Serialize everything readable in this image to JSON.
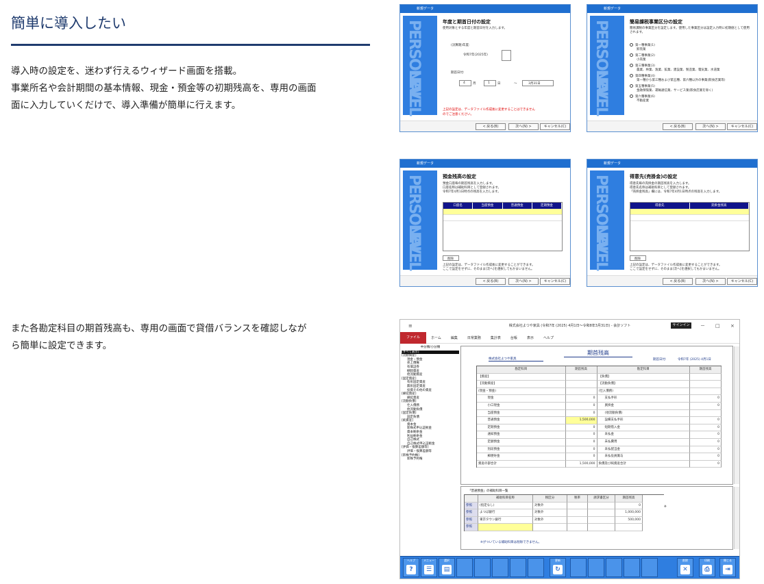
{
  "section1": {
    "heading": "簡単に導入したい",
    "line1": "導入時の設定を、迷わず行えるウィザード画面を搭載。",
    "line2": "事業所名や会計期間の基本情報、現金・預金等の初期残高を、専用の画面",
    "line3": "面に入力していくだけで、導入準備が簡単に行えます。"
  },
  "section2": {
    "line1": "また各勘定科目の期首残高も、専用の画面で貸借バランスを確認しなが",
    "line2": "ら簡単に設定できます。"
  },
  "wizard_common": {
    "titlebar": "新規データ",
    "side_text_a": "PERSONAL",
    "side_text_b": "LEVEL",
    "back": "< 戻る(B)",
    "next": "次へ(N) >",
    "cancel": "キャンセル(C)"
  },
  "wizard1": {
    "title": "年度と期首日付の設定",
    "desc": "使用対象とする年度と期首日付を入力します。",
    "year_label": "(決算期)年度:",
    "year_value": "令和7年(2025年)",
    "date_label": "期首日付:",
    "month": "4",
    "month_unit": "月",
    "day": "1",
    "day_unit": "日",
    "tilde": "〜",
    "end": "3月31日",
    "warning": "上記の設定は、データファイル作成後に変更することはできません",
    "warning2": "のでご注意ください。"
  },
  "wizard2": {
    "title": "簡易課税事業区分の設定",
    "desc": "簡易課税の事業区分を設定します。使用した事業区分は設定入力時に初期値として使用されます。",
    "options": [
      {
        "label": "第一種事業(1)",
        "sub": "卸売業"
      },
      {
        "label": "第二種事業(2)",
        "sub": "小売業"
      },
      {
        "label": "第三種事業(3)",
        "sub": "農業、林業、漁業、鉱業、建設業、製造業、電気業、水道業"
      },
      {
        "label": "第四種事業(4)",
        "sub": "第一種から第三種および第五種、第六種以外の事業(飲食店業等)"
      },
      {
        "label": "第五種事業(5)",
        "sub": "金融保険業、運輸通信業、サービス業(飲食店業を除く)"
      },
      {
        "label": "第六種事業(6)",
        "sub": "不動産業"
      }
    ]
  },
  "wizard3": {
    "title": "預金残高の設定",
    "desc1": "預金口座毎の期首残高を入力します。",
    "desc2": "口座名称は補助科目として登録されます。",
    "desc3": "令和7年4月1日時点の残高を入力します。",
    "cols": [
      "口座名",
      "当座預金",
      "普通預金",
      "定期預金"
    ],
    "delete_btn": "削除",
    "note1": "上記の設定は、データファイル作成後に変更することができます。",
    "note2": "ここで設定をせずに、そのまま[次へ]を選択してもかまいません。"
  },
  "wizard4": {
    "title": "得意先(売掛金)の設定",
    "desc1": "得意先毎の売掛金の期首残高を入力します。",
    "desc2": "得意先名称は補助科目として登録されます。",
    "desc3": "「売掛金残高」欄には、令和7年4月1日時点の残高を入力します。",
    "cols": [
      "得意先",
      "売掛金残高"
    ],
    "delete_btn": "削除",
    "note1": "上記の設定は、データファイル作成後に変更することができます。",
    "note2": "ここで設定をせずに、そのまま[次へ]を選択してもかまいません。"
  },
  "app": {
    "caption": "株式会社よつや家具 (令和7年 (2025) 4月1日〜令和8年3月31日) - 会計ソフト",
    "signin": "サインイン",
    "menu": [
      "ファイル",
      "ホーム",
      "編集",
      "日常業務",
      "集計表",
      "台帳",
      "表示",
      "ヘルプ"
    ],
    "tree": [
      "中分類/小分類",
      "[すべて表示]",
      "[流動資産]",
      "現金・預金",
      "売上債権",
      "有価証券",
      "棚卸資産",
      "他流動資産",
      "[固定資産]",
      "有形固定資産",
      "無形固定資産",
      "投資その他の資産",
      "[繰延資産]",
      "繰延資産",
      "[流動負債]",
      "仕入債務",
      "他流動負債",
      "[固定負債]",
      "固定負債",
      "[純資産]",
      "資本金",
      "新株式申込証拠金",
      "資本剰余金",
      "利益剰余金",
      "自己株式",
      "自己株式申込証拠金",
      "[評価・換算差額等]",
      "評価・換算差額等",
      "[新株予約権]",
      "新株予約権"
    ],
    "panel_title": "期首残高",
    "company": "株式会社よつや家具",
    "start_date_label": "期首日付:",
    "start_date": "令和7年 (2025) 4月1日",
    "headers": [
      "勘定科目",
      "期首残高",
      "勘定科目",
      "期首残高"
    ],
    "assets_label": "【資産】",
    "liab_label": "【負債】",
    "current_assets": "【流動資産】",
    "current_liab": "【流動負債】",
    "cash_group": "(現金・預金)",
    "purchase_group": "(仕入債務)",
    "other_group": "(他流動負債)",
    "left_rows": [
      {
        "name": "現金",
        "value": "0"
      },
      {
        "name": "小口現金",
        "value": "0"
      },
      {
        "name": "当座預金",
        "value": "0"
      },
      {
        "name": "普通預金",
        "value": "1,500,000"
      },
      {
        "name": "定期預金",
        "value": "0"
      },
      {
        "name": "通知預金",
        "value": "0"
      },
      {
        "name": "定額預金",
        "value": "0"
      },
      {
        "name": "別段預金",
        "value": "0"
      },
      {
        "name": "郵便貯金",
        "value": "0"
      }
    ],
    "right_rows1": [
      {
        "name": "支払手形",
        "value": "0"
      },
      {
        "name": "買掛金",
        "value": "0"
      }
    ],
    "right_rows2": [
      {
        "name": "設備支払手形",
        "value": "0"
      },
      {
        "name": "短期借入金",
        "value": "0"
      },
      {
        "name": "未払金",
        "value": "0"
      },
      {
        "name": "未払費用",
        "value": "0"
      },
      {
        "name": "未払配当金",
        "value": "0"
      },
      {
        "name": "未払役員賞与",
        "value": "0"
      }
    ],
    "total_assets_label": "資産の部合計",
    "total_assets": "1,500,000",
    "total_liab_label": "負債及び純資産合計",
    "total_liab": "0",
    "sub_title": "「普通預金」の補助科目一覧",
    "sub_headers": [
      "補助科目名称",
      "税区分",
      "税率",
      "請求書区分",
      "期首残高"
    ],
    "sub_rows": [
      {
        "btn": "参照",
        "name": "(指定なし)",
        "tax": "対象外",
        "value": "0"
      },
      {
        "btn": "参照",
        "name": "よつば銀行",
        "tax": "対象外",
        "value": "1,000,000"
      },
      {
        "btn": "参照",
        "name": "東京タウン銀行",
        "tax": "対象外",
        "value": "500,000"
      },
      {
        "btn": "参照",
        "name": "",
        "tax": "",
        "value": ""
      }
    ],
    "sub_note": "※がついている補助科目は削除できません。",
    "toolbar": {
      "help": "ヘルプ",
      "menu": "メニュー",
      "select": "選択",
      "update": "更新",
      "delete": "削除",
      "print": "印刷",
      "close": "閉じる"
    }
  }
}
